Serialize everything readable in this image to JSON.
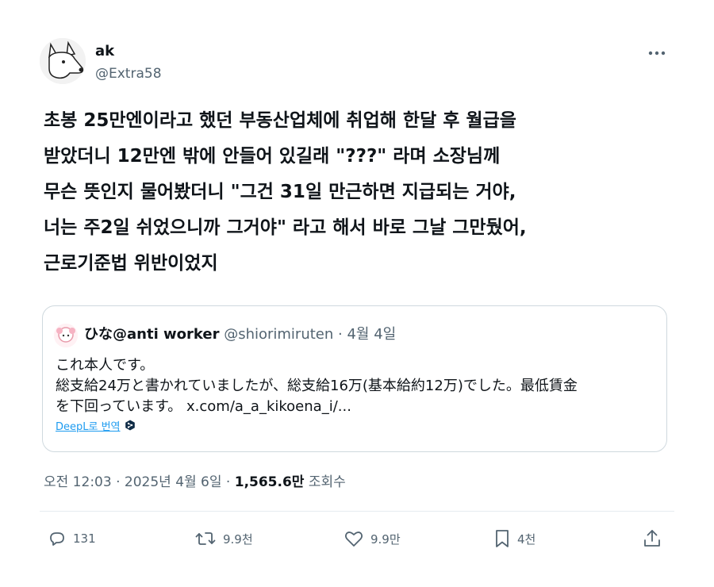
{
  "author": {
    "name": "ak",
    "handle": "@Extra58"
  },
  "tweet_lines": [
    "초봉 25만엔이라고 했던 부동산업체에 취업해 한달 후 월급을",
    "받았더니 12만엔 밖에 안들어 있길래 \"???\" 라며 소장님께",
    "무슨 뜻인지 물어봤더니 \"그건 31일 만근하면 지급되는 거야,",
    "너는 주2일 쉬었으니까 그거야\" 라고 해서 바로 그날 그만뒀어,",
    "근로기준법 위반이었지"
  ],
  "quote": {
    "name": "ひな@anti worker",
    "handle": "@shiorimiruten",
    "separator": "·",
    "date": "4월 4일",
    "lines": [
      "これ本人です。",
      "総支給24万と書かれていましたが、総支給16万(基本給約12万)でした。最低賃金",
      "を下回っています。 x.com/a_a_kikoena_i/..."
    ],
    "translate_label": "DeepL로 번역"
  },
  "meta": {
    "timestamp": "오전 12:03 · 2025년 4월 6일 · ",
    "views_count": "1,565.6만",
    "views_label": " 조회수"
  },
  "actions": {
    "replies": "131",
    "retweets": "9.9천",
    "likes": "9.9만",
    "bookmarks": "4천"
  },
  "icons": {
    "more": "more-icon",
    "reply": "reply-icon",
    "retweet": "retweet-icon",
    "like": "heart-icon",
    "bookmark": "bookmark-icon",
    "share": "share-icon",
    "deepl": "deepl-icon"
  },
  "colors": {
    "text": "#0f1419",
    "secondary": "#536471",
    "link": "#1d9bf0",
    "border": "#cfd9de"
  }
}
